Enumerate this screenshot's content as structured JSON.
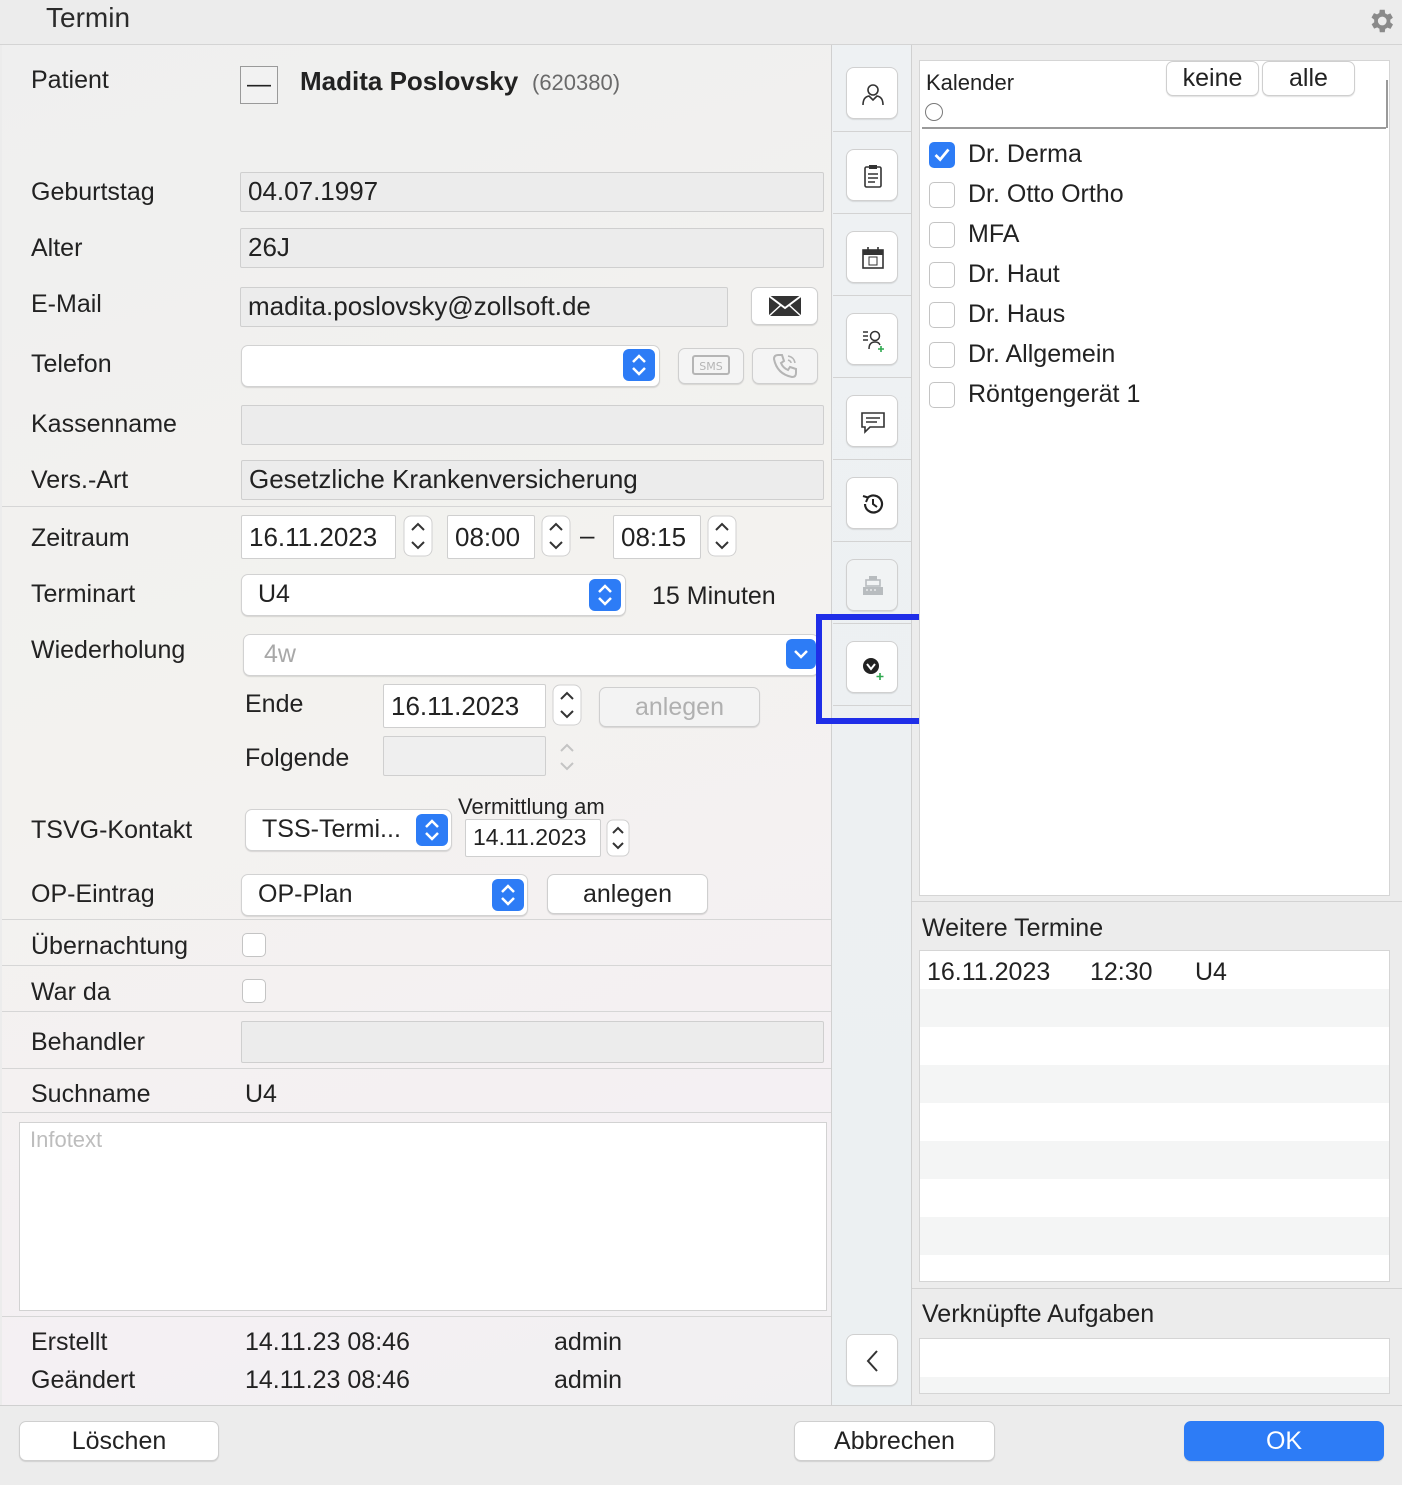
{
  "window": {
    "title": "Termin"
  },
  "patient": {
    "label": "Patient",
    "toggle": "—",
    "name": "Madita Poslovsky",
    "id": "(620380)"
  },
  "form": {
    "geburtstag_label": "Geburtstag",
    "geburtstag": "04.07.1997",
    "alter_label": "Alter",
    "alter": "26J",
    "email_label": "E-Mail",
    "email": "madita.poslovsky@zollsoft.de",
    "telefon_label": "Telefon",
    "telefon": "",
    "sms_label": "SMS",
    "kassenname_label": "Kassenname",
    "kassenname": "",
    "versart_label": "Vers.-Art",
    "versart": "Gesetzliche Krankenversicherung",
    "zeitraum_label": "Zeitraum",
    "zeitraum_date": "16.11.2023",
    "zeitraum_start": "08:00",
    "zeitraum_dash": "–",
    "zeitraum_end": "08:15",
    "terminart_label": "Terminart",
    "terminart": "U4",
    "duration": "15 Minuten",
    "wiederholung_label": "Wiederholung",
    "wiederholung": "4w",
    "ende_label": "Ende",
    "ende": "16.11.2023",
    "ende_button": "anlegen",
    "folgende_label": "Folgende",
    "folgende": "",
    "tsvg_label": "TSVG-Kontakt",
    "tsvg": "TSS-Termi...",
    "vermittlung_label": "Vermittlung am",
    "vermittlung": "14.11.2023",
    "op_label": "OP-Eintrag",
    "op": "OP-Plan",
    "op_button": "anlegen",
    "uebernachtung_label": "Übernachtung",
    "warda_label": "War da",
    "behandler_label": "Behandler",
    "behandler": "",
    "suchname_label": "Suchname",
    "suchname": "U4",
    "infotext_placeholder": "Infotext",
    "erstellt_label": "Erstellt",
    "erstellt_date": "14.11.23 08:46",
    "erstellt_user": "admin",
    "geaendert_label": "Geändert",
    "geaendert_date": "14.11.23 08:46",
    "geaendert_user": "admin"
  },
  "sidebar_icons": [
    "person-icon",
    "clipboard-icon",
    "calendar-icon",
    "person-add-icon",
    "chat-icon",
    "history-icon",
    "cash-register-icon",
    "tag-add-icon",
    "chevron-left-icon"
  ],
  "calendar": {
    "header": "Kalender",
    "btn_none": "keine",
    "btn_all": "alle",
    "items": [
      {
        "label": "Dr. Derma",
        "checked": true
      },
      {
        "label": "Dr. Otto Ortho",
        "checked": false
      },
      {
        "label": "MFA",
        "checked": false
      },
      {
        "label": "Dr. Haut",
        "checked": false
      },
      {
        "label": "Dr. Haus",
        "checked": false
      },
      {
        "label": "Dr. Allgemein",
        "checked": false
      },
      {
        "label": "Röntgengerät 1",
        "checked": false
      }
    ]
  },
  "weitere": {
    "title": "Weitere Termine",
    "rows": [
      {
        "date": "16.11.2023",
        "time": "12:30",
        "type": "U4"
      }
    ]
  },
  "aufgaben": {
    "title": "Verknüpfte Aufgaben"
  },
  "footer": {
    "delete": "Löschen",
    "cancel": "Abbrechen",
    "ok": "OK"
  },
  "colors": {
    "accent": "#2d7cf6",
    "annotation": "#1f2ee8"
  }
}
